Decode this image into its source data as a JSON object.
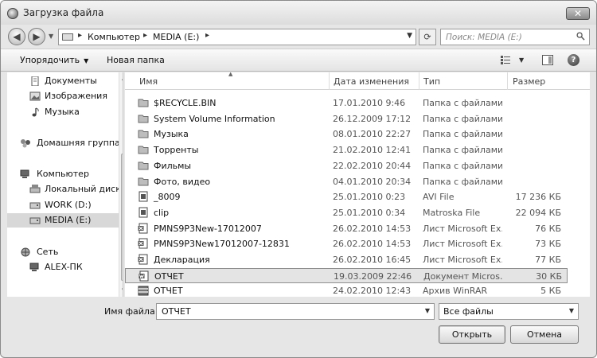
{
  "window": {
    "title": "Загрузка файла"
  },
  "address": {
    "crumbs": [
      "Компьютер",
      "MEDIA (E:)"
    ],
    "search_placeholder": "Поиск: MEDIA (E:)"
  },
  "toolbar": {
    "organize_label": "Упорядочить",
    "new_folder_label": "Новая папка"
  },
  "sidebar": {
    "items": [
      {
        "label": "Документы",
        "icon": "documents-icon"
      },
      {
        "label": "Изображения",
        "icon": "pictures-icon"
      },
      {
        "label": "Музыка",
        "icon": "music-icon"
      },
      {
        "label": "Домашняя группа",
        "icon": "homegroup-icon"
      },
      {
        "label": "Компьютер",
        "icon": "computer-icon"
      },
      {
        "label": "Локальный диск",
        "icon": "drive-icon"
      },
      {
        "label": "WORK (D:)",
        "icon": "drive-icon"
      },
      {
        "label": "MEDIA (E:)",
        "icon": "drive-icon"
      },
      {
        "label": "Сеть",
        "icon": "network-icon"
      },
      {
        "label": "ALEX-ПК",
        "icon": "pc-icon"
      }
    ]
  },
  "columns": {
    "name": "Имя",
    "date": "Дата изменения",
    "type": "Тип",
    "size": "Размер"
  },
  "files": [
    {
      "name": "$RECYCLE.BIN",
      "date": "17.01.2010 9:46",
      "type": "Папка с файлами",
      "size": "",
      "icon": "folder-icon"
    },
    {
      "name": "System Volume Information",
      "date": "26.12.2009 17:12",
      "type": "Папка с файлами",
      "size": "",
      "icon": "folder-icon"
    },
    {
      "name": "Музыка",
      "date": "08.01.2010 22:27",
      "type": "Папка с файлами",
      "size": "",
      "icon": "folder-icon"
    },
    {
      "name": "Торренты",
      "date": "21.02.2010 12:41",
      "type": "Папка с файлами",
      "size": "",
      "icon": "folder-icon"
    },
    {
      "name": "Фильмы",
      "date": "22.02.2010 20:44",
      "type": "Папка с файлами",
      "size": "",
      "icon": "folder-icon"
    },
    {
      "name": "Фото, видео",
      "date": "04.01.2010 20:34",
      "type": "Папка с файлами",
      "size": "",
      "icon": "folder-icon"
    },
    {
      "name": "_8009",
      "date": "25.01.2010 0:23",
      "type": "AVI File",
      "size": "17 236 КБ",
      "icon": "video-file-icon"
    },
    {
      "name": "clip",
      "date": "25.01.2010 0:34",
      "type": "Matroska File",
      "size": "22 094 КБ",
      "icon": "video-file-icon"
    },
    {
      "name": "PMNS9P3New-17012007",
      "date": "26.02.2010 14:53",
      "type": "Лист Microsoft Ex...",
      "size": "76 КБ",
      "icon": "excel-file-icon"
    },
    {
      "name": "PMNS9P3New17012007-12831",
      "date": "26.02.2010 14:53",
      "type": "Лист Microsoft Ex...",
      "size": "73 КБ",
      "icon": "excel-file-icon"
    },
    {
      "name": "Декларация",
      "date": "26.02.2010 16:45",
      "type": "Лист Microsoft Ex...",
      "size": "77 КБ",
      "icon": "excel-file-icon"
    },
    {
      "name": "ОТЧЕТ",
      "date": "19.03.2009 22:46",
      "type": "Документ Micros...",
      "size": "30 КБ",
      "icon": "word-file-icon"
    },
    {
      "name": "ОТЧЕТ",
      "date": "24.02.2010 12:43",
      "type": "Архив WinRAR",
      "size": "5 КБ",
      "icon": "archive-file-icon"
    }
  ],
  "bottom": {
    "filename_label": "Имя файла:",
    "filename_value": "ОТЧЕТ",
    "filetype_value": "Все файлы",
    "open_label": "Открыть",
    "cancel_label": "Отмена"
  }
}
